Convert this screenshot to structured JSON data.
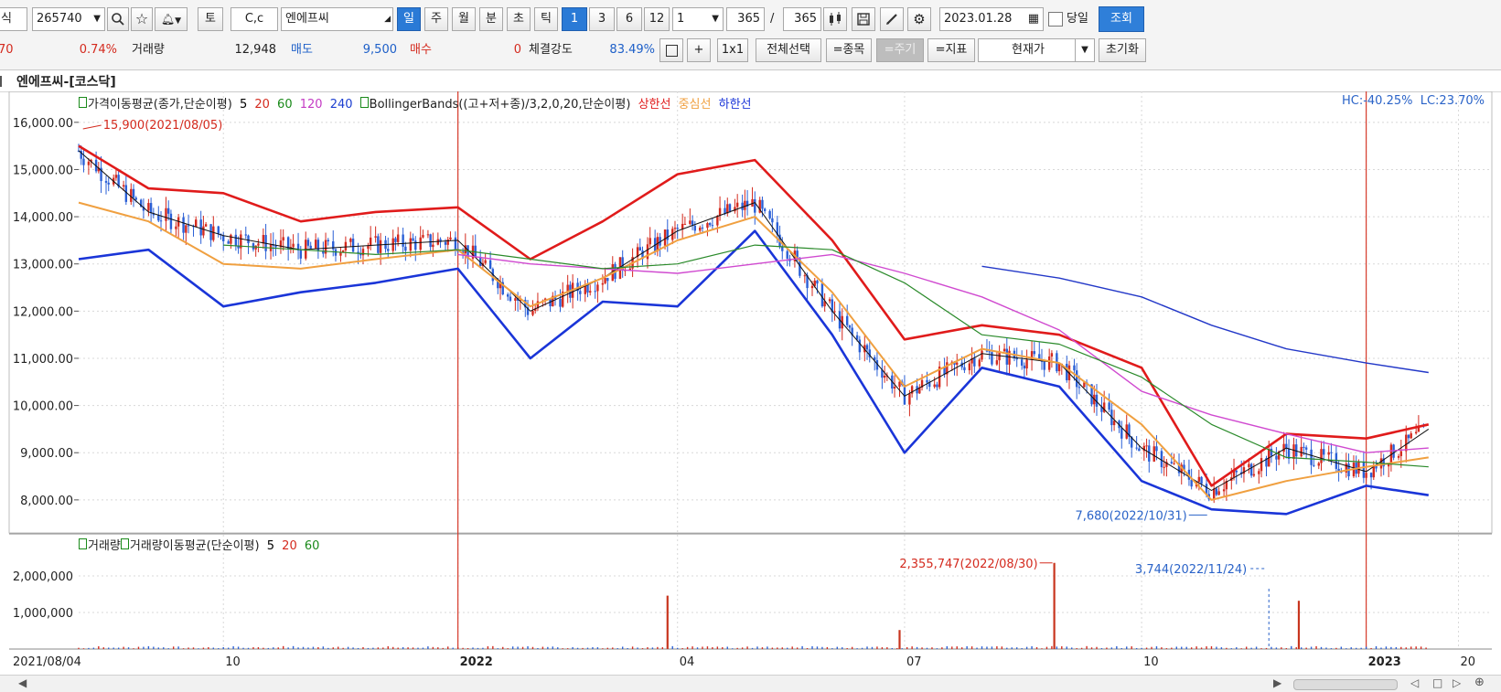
{
  "toolbar": {
    "row1": {
      "left_fragment": "식",
      "code": "265740",
      "ctrl_cc": "C,c",
      "stock_name": "엔에프씨",
      "period_buttons": [
        "일",
        "주",
        "월",
        "분",
        "초",
        "틱"
      ],
      "num_buttons": [
        "1",
        "3",
        "6",
        "12"
      ],
      "interval_select": "1",
      "count_a": "365",
      "slash": "/",
      "count_b": "365",
      "date": "2023.01.28",
      "same_day_label": "당일",
      "query_button": "조회"
    },
    "row2": {
      "change_fragment": "70",
      "change_pct": "0.74%",
      "volume_label": "거래량",
      "volume_value": "12,948",
      "sell_label": "매도",
      "sell_value": "9,500",
      "buy_label": "매수",
      "buy_value": "0",
      "strength_label": "체결강도",
      "strength_value": "83.49%",
      "plus": "+",
      "one_by_one": "1x1",
      "select_all": "전체선택",
      "item_btn": "=종목",
      "period_btn": "=주기",
      "indicator_btn": "=지표",
      "price_select": "현재가",
      "reset": "초기화"
    }
  },
  "chart_title": "엔에프씨-[코스닥]",
  "price_legend": {
    "ma_label": "가격이동평균(종가,단순이평)",
    "ma_periods": [
      "5",
      "20",
      "60",
      "120",
      "240"
    ],
    "ma_colors": [
      "#000000",
      "#d42a1e",
      "#1a8a1a",
      "#c43cc4",
      "#1d3fd0"
    ],
    "bb_label": "BollingerBands((고+저+종)/3,2,0,20,단순이평)",
    "bb_items": [
      "상한선",
      "중심선",
      "하한선"
    ],
    "bb_colors": [
      "#e01b1b",
      "#f0a040",
      "#1a35d8"
    ],
    "hc_lc": "HC:-40.25%  LC:23.70%"
  },
  "volume_legend": {
    "label1": "거래량",
    "label2": "거래량이동평균(단순이평)",
    "periods": [
      "5",
      "20",
      "60"
    ],
    "colors": [
      "#000000",
      "#d42a1e",
      "#1a8a1a"
    ]
  },
  "annotations": {
    "high": "15,900(2021/08/05)",
    "low": "7,680(2022/10/31)",
    "vol_high": "2,355,747(2022/08/30)",
    "vol_low": "3,744(2022/11/24)"
  },
  "chart_data": {
    "type": "line",
    "title": "엔에프씨-[코스닥]",
    "x_axis_labels": [
      "2021/08/04",
      "10",
      "2022",
      "04",
      "07",
      "10",
      "2023",
      "20"
    ],
    "y_axis_price": {
      "ticks": [
        "16,000.00",
        "15,000.00",
        "14,000.00",
        "13,000.00",
        "12,000.00",
        "11,000.00",
        "10,000.00",
        "9,000.00",
        "8,000.00"
      ],
      "ylim": [
        7300,
        16500
      ]
    },
    "y_axis_volume": {
      "ticks": [
        "2,000,000",
        "1,000,000"
      ],
      "ylim": [
        0,
        2900000
      ]
    },
    "dates": [
      "2021-08-04",
      "2021-09-01",
      "2021-10-01",
      "2021-11-01",
      "2021-12-01",
      "2022-01-03",
      "2022-02-01",
      "2022-03-02",
      "2022-04-01",
      "2022-05-02",
      "2022-06-02",
      "2022-07-01",
      "2022-08-01",
      "2022-09-01",
      "2022-10-04",
      "2022-11-01",
      "2022-12-01",
      "2023-01-02",
      "2023-01-27"
    ],
    "series": [
      {
        "name": "5",
        "values": [
          15400,
          14100,
          13600,
          13300,
          13400,
          13500,
          12000,
          12700,
          13700,
          14300,
          12000,
          10200,
          11100,
          10900,
          9100,
          8200,
          9100,
          8600,
          9500
        ]
      },
      {
        "name": "상한선",
        "values": [
          15500,
          14600,
          14500,
          13900,
          14100,
          14200,
          13100,
          13900,
          14900,
          15200,
          13500,
          11400,
          11700,
          11500,
          10800,
          8300,
          9400,
          9300,
          9600
        ]
      },
      {
        "name": "중심선",
        "values": [
          14300,
          13900,
          13000,
          12900,
          13100,
          13300,
          12100,
          12700,
          13500,
          14000,
          12400,
          10400,
          11200,
          10900,
          9600,
          8000,
          8400,
          8700,
          8900
        ]
      },
      {
        "name": "하한선",
        "values": [
          13100,
          13300,
          12100,
          12400,
          12600,
          12900,
          11000,
          12200,
          12100,
          13700,
          11500,
          9000,
          10800,
          10400,
          8400,
          7800,
          7700,
          8300,
          8100
        ]
      },
      {
        "name": "120",
        "values": [
          null,
          null,
          null,
          null,
          null,
          13200,
          13000,
          12900,
          12800,
          13000,
          13200,
          12800,
          12300,
          11600,
          10300,
          9800,
          9400,
          9000,
          9100
        ]
      },
      {
        "name": "240",
        "values": [
          null,
          null,
          null,
          null,
          null,
          null,
          null,
          null,
          null,
          null,
          null,
          null,
          12950,
          12700,
          12300,
          11700,
          11200,
          10900,
          10700
        ]
      },
      {
        "name": "60",
        "values": [
          null,
          null,
          13400,
          13300,
          13200,
          13300,
          13100,
          12900,
          13000,
          13400,
          13300,
          12600,
          11500,
          11300,
          10600,
          9600,
          8900,
          8800,
          8700
        ]
      }
    ],
    "volume_spikes": [
      {
        "date": "2022-03-28",
        "value": 1460000
      },
      {
        "date": "2022-08-30",
        "value": 2355747
      },
      {
        "date": "2022-12-06",
        "value": 1320000
      },
      {
        "date": "2022-06-29",
        "value": 520000
      }
    ],
    "high_point": {
      "date": "2021-08-05",
      "value": 15900
    },
    "low_point": {
      "date": "2022-10-31",
      "value": 7680
    }
  }
}
